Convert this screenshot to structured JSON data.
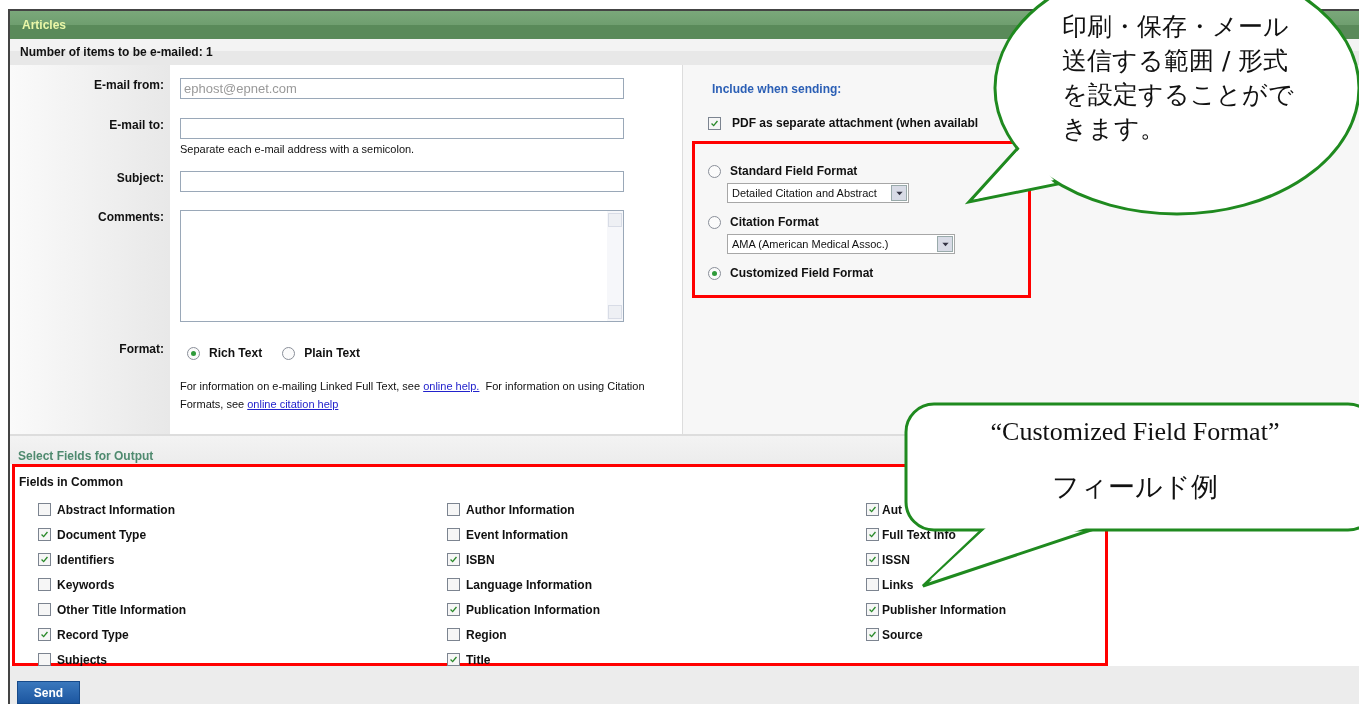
{
  "panel": {
    "title": "Articles",
    "count": "Number of items to be e-mailed: 1"
  },
  "form": {
    "fields": [
      {
        "kind": "input",
        "label": "E-mail from:",
        "placeholder": "ephost@epnet.com"
      },
      {
        "kind": "input",
        "label": "E-mail to:",
        "hint": "Separate each e-mail address with a semicolon."
      },
      {
        "kind": "input",
        "label": "Subject:"
      },
      {
        "kind": "textarea",
        "label": "Comments:"
      }
    ],
    "format": {
      "label": "Format:",
      "options": [
        {
          "label": "Rich Text",
          "selected": true
        },
        {
          "label": "Plain Text",
          "selected": false
        }
      ]
    },
    "help": {
      "text_1": "For information on e-mailing Linked Full Text, see",
      "link_1": "online help.",
      "text_2": "For information on using Citation Formats, see",
      "link_2": "online citation help"
    }
  },
  "include": {
    "heading": "Include when sending:",
    "pdf": {
      "label": "PDF as separate attachment (when availabl",
      "checked": true
    },
    "formats": [
      {
        "label": "Standard Field Format",
        "selected": false,
        "select": "Detailed Citation and Abstract"
      },
      {
        "label": "Citation Format",
        "selected": false,
        "select": "AMA (American Medical Assoc.)"
      },
      {
        "label": "Customized Field Format",
        "selected": true
      }
    ]
  },
  "output": {
    "heading": "Select Fields for Output",
    "group": "Fields in Common",
    "columns": [
      {
        "fields": [
          {
            "label": "Abstract Information",
            "checked": false
          },
          {
            "label": "Document Type",
            "checked": true
          },
          {
            "label": "Identifiers",
            "checked": true
          },
          {
            "label": "Keywords",
            "checked": false
          },
          {
            "label": "Other Title Information",
            "checked": false
          },
          {
            "label": "Record Type",
            "checked": true
          },
          {
            "label": "Subjects",
            "checked": false
          }
        ]
      },
      {
        "fields": [
          {
            "label": "Author Information",
            "checked": false
          },
          {
            "label": "Event Information",
            "checked": false
          },
          {
            "label": "ISBN",
            "checked": true
          },
          {
            "label": "Language Information",
            "checked": false
          },
          {
            "label": "Publication Information",
            "checked": true
          },
          {
            "label": "Region",
            "checked": false
          },
          {
            "label": "Title",
            "checked": true
          }
        ]
      },
      {
        "fields": [
          {
            "label": "Aut",
            "checked": true
          },
          {
            "label": "Full Text Info",
            "checked": true
          },
          {
            "label": "ISSN",
            "checked": true
          },
          {
            "label": "Links",
            "checked": false
          },
          {
            "label": "Publisher Information",
            "checked": true
          },
          {
            "label": "Source",
            "checked": true
          }
        ]
      }
    ]
  },
  "send_button": "Send",
  "callouts": [
    {
      "lines": [
        "印刷・保存・メール",
        "送信する範囲 / 形式",
        "を設定することがで",
        "きます。"
      ]
    },
    {
      "title": "“Customized Field Format”",
      "subtitle": "フィールド例"
    }
  ]
}
